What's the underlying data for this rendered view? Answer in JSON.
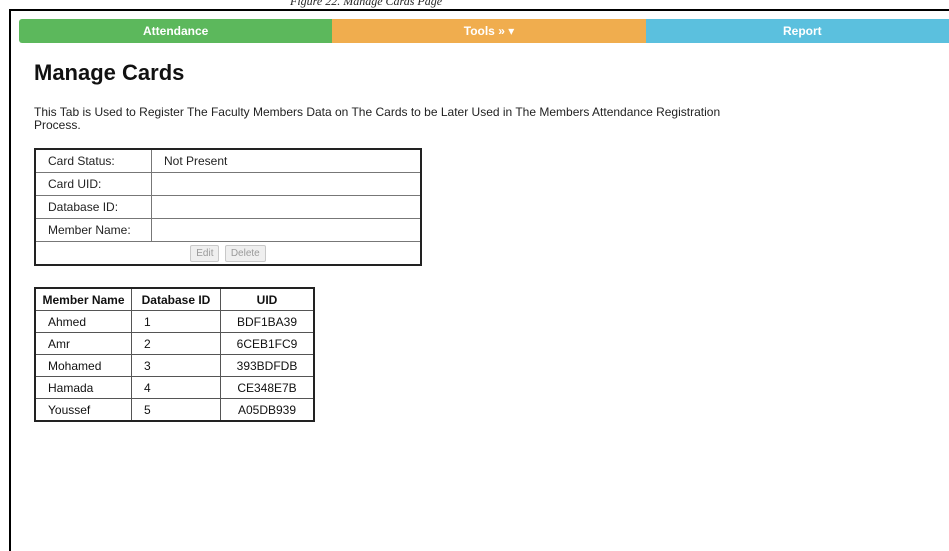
{
  "window": {
    "caption": "Figure 22. Manage Cards Page"
  },
  "nav": {
    "items": [
      {
        "label": "Attendance",
        "color": "#5cb85c"
      },
      {
        "label": "Tools » ▾",
        "color": "#f0ad4e"
      },
      {
        "label": "Report",
        "color": "#5bc0de"
      }
    ]
  },
  "page": {
    "title": "Manage Cards",
    "intro": "This Tab is Used to Register The Faculty Members Data on The Cards to be Later Used in The Members Attendance Registration Process."
  },
  "card_panel": {
    "rows": [
      {
        "label": "Card Status:",
        "value": "Not Present"
      },
      {
        "label": "Card UID:",
        "value": ""
      },
      {
        "label": "Database ID:",
        "value": ""
      },
      {
        "label": "Member Name:",
        "value": ""
      }
    ],
    "edit_label": "Edit",
    "delete_label": "Delete"
  },
  "members_table": {
    "headers": [
      "Member Name",
      "Database ID",
      "UID"
    ],
    "rows": [
      {
        "name": "Ahmed",
        "id": "1",
        "uid": "BDF1BA39"
      },
      {
        "name": "Amr",
        "id": "2",
        "uid": "6CEB1FC9"
      },
      {
        "name": "Mohamed",
        "id": "3",
        "uid": "393BDFDB"
      },
      {
        "name": "Hamada",
        "id": "4",
        "uid": "CE348E7B"
      },
      {
        "name": "Youssef",
        "id": "5",
        "uid": "A05DB939"
      }
    ]
  }
}
